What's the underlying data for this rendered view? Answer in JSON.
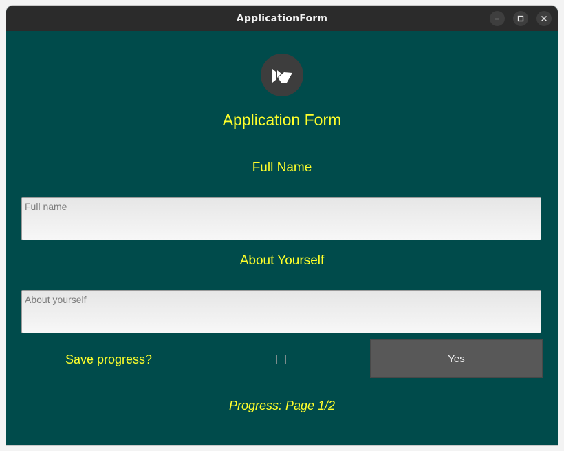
{
  "window": {
    "title": "ApplicationForm",
    "controls": [
      "minimize-icon",
      "maximize-icon",
      "close-icon"
    ]
  },
  "form": {
    "logo": "kivy-logo-icon",
    "heading": "Application Form",
    "full_name_label": "Full Name",
    "full_name_placeholder": "Full name",
    "full_name_value": "",
    "about_label": "About Yourself",
    "about_placeholder": "About yourself",
    "about_value": "",
    "save_progress_label": "Save progress?",
    "save_progress_checked": false,
    "yes_button": "Yes",
    "progress_text": "Progress: Page 1/2"
  },
  "colors": {
    "background": "#004b4b",
    "accent_text": "#ffff2a",
    "titlebar": "#2b2b2b",
    "button": "#585858"
  }
}
